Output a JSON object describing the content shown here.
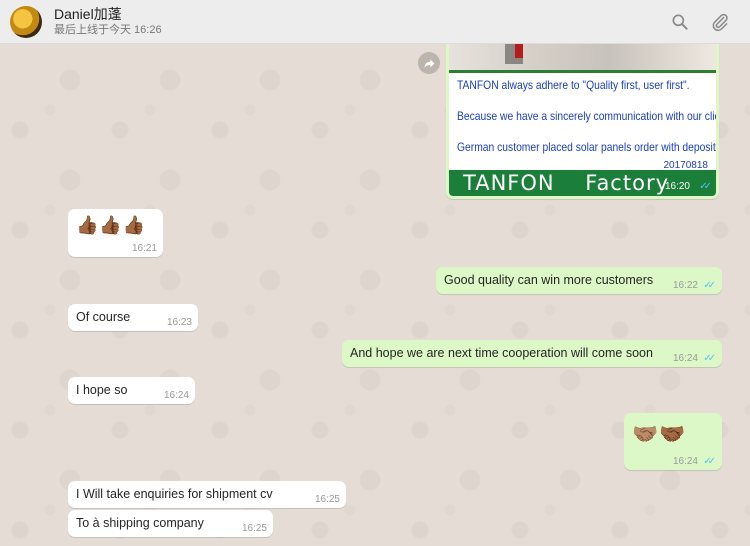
{
  "header": {
    "contact_name": "Daniel加蓬",
    "last_seen": "最后上线于今天 16:26",
    "search_icon": "search-icon",
    "attach_icon": "paperclip-icon"
  },
  "image_message": {
    "lines": [
      "TANFON always adhere to \"Quality first, user first\".",
      "Because we have a sincerely  communication with our client.",
      "German customer placed solar panels order with deposit"
    ],
    "date": "20170818",
    "footer": "TANFON    Factory",
    "time": "16:20",
    "ticks": "✓✓",
    "forward_icon": "forward-icon"
  },
  "messages": [
    {
      "id": "m1",
      "direction": "in",
      "text": "👍🏾👍🏾👍🏾",
      "time": "16:21"
    },
    {
      "id": "m2",
      "direction": "out",
      "text": "Good quality can win more customers",
      "time": "16:22",
      "ticks": "✓✓"
    },
    {
      "id": "m3",
      "direction": "in",
      "text": "Of course",
      "time": "16:23"
    },
    {
      "id": "m4",
      "direction": "out",
      "text": "And hope we are next time cooperation will come soon",
      "time": "16:24",
      "ticks": "✓✓"
    },
    {
      "id": "m5",
      "direction": "in",
      "text": "I hope so",
      "time": "16:24"
    },
    {
      "id": "m6",
      "direction": "out",
      "text": "🤝🏽🤝🏾",
      "time": "16:24",
      "ticks": "✓✓"
    },
    {
      "id": "m7",
      "direction": "in",
      "text": "I Will take enquiries for shipment  cv",
      "time": "16:25"
    },
    {
      "id": "m8",
      "direction": "in",
      "text": "To à shipping company",
      "time": "16:25"
    }
  ],
  "colors": {
    "incoming_bubble": "#ffffff",
    "outgoing_bubble": "#dcf8c6",
    "read_ticks": "#4fc3f7",
    "chat_background": "#e5ddd5"
  }
}
